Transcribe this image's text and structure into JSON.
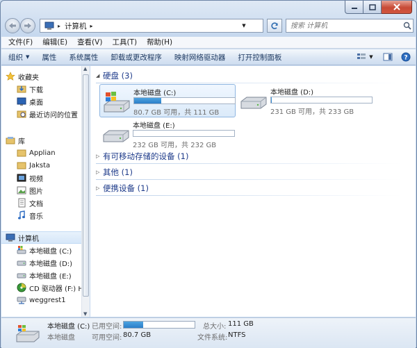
{
  "window": {
    "caption": {
      "minimize": "minimize",
      "maximize": "maximize",
      "close": "close"
    }
  },
  "address": {
    "crumb": "计算机",
    "separator": "▸"
  },
  "search": {
    "placeholder": "搜索 计算机"
  },
  "menu": [
    "文件(F)",
    "编辑(E)",
    "查看(V)",
    "工具(T)",
    "帮助(H)"
  ],
  "toolbar": {
    "organize": "组织",
    "items": [
      "属性",
      "系统属性",
      "卸载或更改程序",
      "映射网络驱动器",
      "打开控制面板"
    ]
  },
  "nav": {
    "favorites": {
      "label": "收藏夹",
      "items": [
        "下载",
        "桌面",
        "最近访问的位置"
      ]
    },
    "library": {
      "label": "库",
      "items": [
        "Applian",
        "Jaksta",
        "视频",
        "图片",
        "文档",
        "音乐"
      ]
    },
    "computer": {
      "label": "计算机",
      "items": [
        "本地磁盘 (C:)",
        "本地磁盘 (D:)",
        "本地磁盘 (E:)",
        "CD 驱动器 (F:) H",
        "weggrest1"
      ]
    }
  },
  "groups": {
    "hdd": "硬盘 (3)",
    "removable": "有可移动存储的设备 (1)",
    "other": "其他 (1)",
    "portable": "便携设备 (1)"
  },
  "drives": [
    {
      "name": "本地磁盘 (C:)",
      "free": "80.7 GB 可用，共 111 GB",
      "used_fraction": 0.27
    },
    {
      "name": "本地磁盘 (D:)",
      "free": "231 GB 可用，共 233 GB",
      "used_fraction": 0.01
    },
    {
      "name": "本地磁盘 (E:)",
      "free": "232 GB 可用，共 232 GB",
      "used_fraction": 0.0
    }
  ],
  "status": {
    "name": "本地磁盘 (C:)",
    "type": "本地磁盘",
    "used_label": "已用空间:",
    "free_label": "可用空间:",
    "free_value": "80.7 GB",
    "total_label": "总大小:",
    "total_value": "111 GB",
    "fs_label": "文件系统:",
    "fs_value": "NTFS",
    "used_fraction": 0.27
  },
  "colors": {
    "accent": "#2b7ec8",
    "group_heading": "#1e3b8a"
  }
}
